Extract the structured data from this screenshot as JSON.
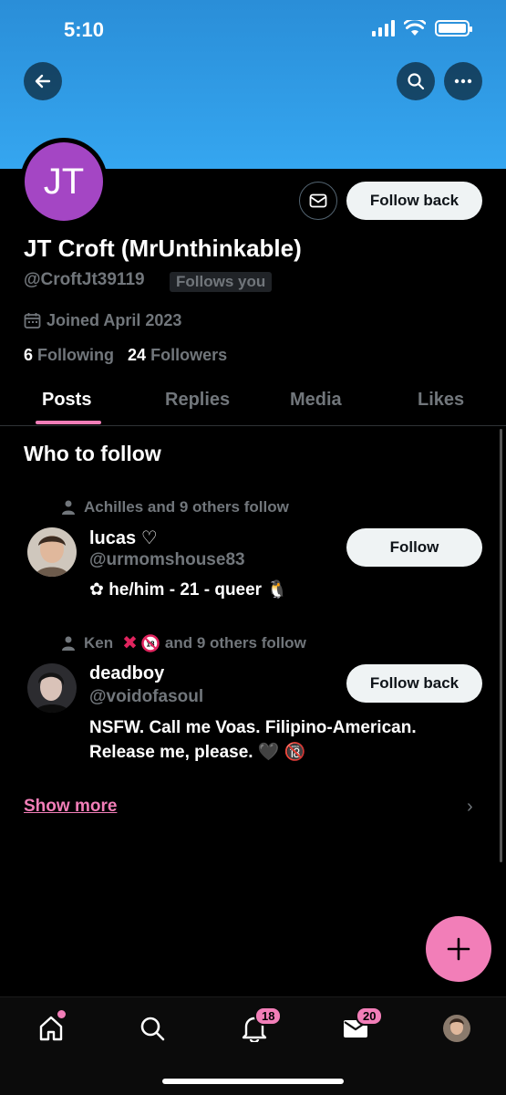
{
  "status_bar": {
    "time": "5:10"
  },
  "profile": {
    "avatar_initials": "JT",
    "display_name": "JT Croft (MrUnthinkable)",
    "handle": "@CroftJt39119",
    "follows_you_label": "Follows you",
    "joined": "Joined April 2023",
    "following_count": "6",
    "following_label": "Following",
    "followers_count": "24",
    "followers_label": "Followers",
    "follow_back_label": "Follow back"
  },
  "tabs": [
    {
      "label": "Posts",
      "active": true
    },
    {
      "label": "Replies",
      "active": false
    },
    {
      "label": "Media",
      "active": false
    },
    {
      "label": "Likes",
      "active": false
    }
  ],
  "who_to_follow": {
    "title": "Who to follow",
    "suggestions": [
      {
        "social_context": "Achilles and 9 others follow",
        "name": "lucas ♡",
        "handle": "@urmomshouse83",
        "bio": "✿ he/him - 21 - queer 🐧",
        "button_label": "Follow"
      },
      {
        "social_context_prefix": "Ken",
        "social_context_suffix": "and 9 others follow",
        "name": "deadboy",
        "handle": "@voidofasoul",
        "bio": "NSFW. Call me Voas. Filipino-American. Release me, please. 🖤 🔞",
        "button_label": "Follow back"
      }
    ],
    "show_more_label": "Show more"
  },
  "bottom_nav": {
    "notifications_badge": "18",
    "messages_badge": "20"
  },
  "colors": {
    "accent": "#f27eb8",
    "banner": "#35a6f0",
    "avatar_bg": "#a446c4"
  }
}
